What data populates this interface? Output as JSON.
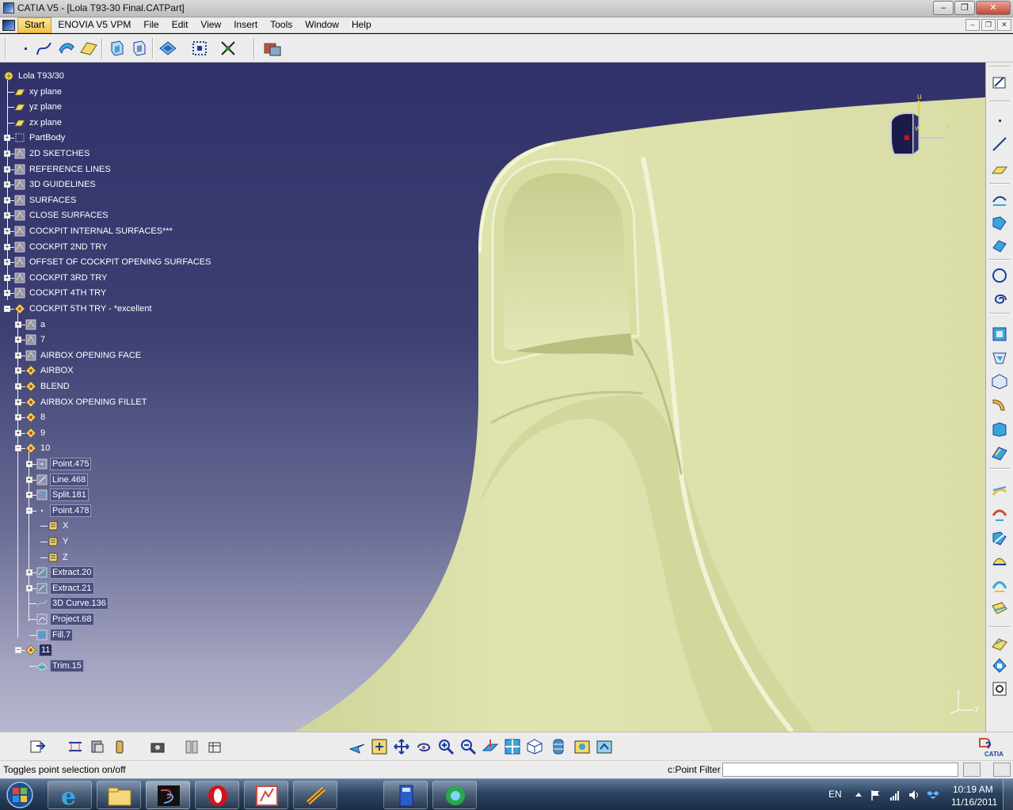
{
  "window": {
    "title": "CATIA V5 - [Lola T93-30 Final.CATPart]",
    "buttons": [
      "minimize",
      "maximize",
      "close"
    ]
  },
  "menubar": {
    "items": [
      "Start",
      "ENOVIA V5 VPM",
      "File",
      "Edit",
      "View",
      "Insert",
      "Tools",
      "Window",
      "Help"
    ],
    "active": "Start"
  },
  "spec_tree": {
    "root": "Lola T93/30",
    "items": [
      {
        "label": "xy plane",
        "icon": "plane-icon"
      },
      {
        "label": "yz plane",
        "icon": "plane-icon"
      },
      {
        "label": "zx plane",
        "icon": "plane-icon"
      },
      {
        "label": "PartBody",
        "icon": "body-icon"
      },
      {
        "label": "2D SKETCHES",
        "icon": "geoset-icon"
      },
      {
        "label": "REFERENCE LINES",
        "icon": "geoset-icon"
      },
      {
        "label": "3D GUIDELINES",
        "icon": "geoset-icon"
      },
      {
        "label": "SURFACES",
        "icon": "geoset-icon"
      },
      {
        "label": "CLOSE SURFACES",
        "icon": "geoset-icon"
      },
      {
        "label": "COCKPIT INTERNAL SURFACES***",
        "icon": "geoset-icon"
      },
      {
        "label": "COCKPIT 2ND TRY",
        "icon": "geoset-icon"
      },
      {
        "label": "OFFSET OF COCKPIT OPENING SURFACES",
        "icon": "geoset-icon"
      },
      {
        "label": "COCKPIT 3RD TRY",
        "icon": "geoset-icon"
      },
      {
        "label": "COCKPIT 4TH TRY",
        "icon": "geoset-icon"
      },
      {
        "label": "COCKPIT 5TH TRY - *excellent",
        "icon": "geoset-active-icon"
      },
      {
        "label": "a",
        "icon": "geoset-icon"
      },
      {
        "label": "7",
        "icon": "geoset-icon"
      },
      {
        "label": "AIRBOX OPENING FACE",
        "icon": "geoset-icon"
      },
      {
        "label": "AIRBOX",
        "icon": "geoset-active-icon"
      },
      {
        "label": "BLEND",
        "icon": "geoset-active-icon"
      },
      {
        "label": "AIRBOX OPENING FILLET",
        "icon": "geoset-active-icon"
      },
      {
        "label": "8",
        "icon": "geoset-active-icon"
      },
      {
        "label": "9",
        "icon": "geoset-active-icon"
      },
      {
        "label": "10",
        "icon": "geoset-active-icon"
      },
      {
        "label": "Point.475",
        "icon": "point-icon"
      },
      {
        "label": "Line.468",
        "icon": "line-icon"
      },
      {
        "label": "Split.181",
        "icon": "split-icon"
      },
      {
        "label": "Point.478",
        "icon": "point-small-icon"
      },
      {
        "label": "X",
        "icon": "parameter-icon"
      },
      {
        "label": "Y",
        "icon": "parameter-icon"
      },
      {
        "label": "Z",
        "icon": "parameter-icon"
      },
      {
        "label": "Extract.20",
        "icon": "extract-icon"
      },
      {
        "label": "Extract.21",
        "icon": "extract-icon"
      },
      {
        "label": "3D Curve.136",
        "icon": "curve-icon"
      },
      {
        "label": "Project.68",
        "icon": "project-icon"
      },
      {
        "label": "Fill.7",
        "icon": "fill-icon"
      },
      {
        "label": "11",
        "icon": "geoset-active-icon"
      },
      {
        "label": "Trim.15",
        "icon": "trim-icon"
      }
    ]
  },
  "compass": {
    "u": "u",
    "v": "v",
    "w": "w"
  },
  "axis_triad": {
    "z": "z",
    "y": "y"
  },
  "statusbar": {
    "message": "Toggles point selection on/off",
    "filter_label": "c:Point Filter",
    "filter_value": ""
  },
  "catia_logo": {
    "text": "CATIA"
  },
  "taskbar": {
    "language": "EN",
    "time": "10:19 AM",
    "date": "11/16/2011"
  }
}
